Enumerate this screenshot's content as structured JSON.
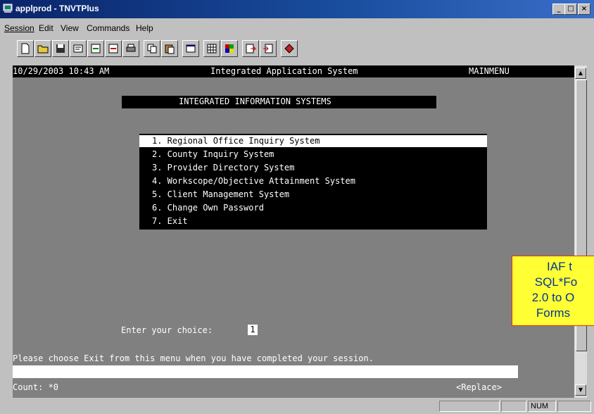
{
  "window": {
    "title": "applprod - TNVTPlus",
    "min": "_",
    "max": "□",
    "close": "×"
  },
  "menu": {
    "session": "Session",
    "edit": "Edit",
    "view": "View",
    "commands": "Commands",
    "help": "Help"
  },
  "toolbar": [
    "new-icon",
    "open-icon",
    "save-icon",
    "properties-icon",
    "connect-icon",
    "disconnect-icon",
    "print-icon",
    "copy-icon",
    "paste-icon",
    "window-icon",
    "grid-icon",
    "color-icon",
    "send-icon",
    "receive-icon",
    "macro-icon"
  ],
  "terminal": {
    "datetime": "10/29/2003 10:43 AM",
    "app_title": "Integrated Application System",
    "screen_id": "MAINMENU",
    "banner": "INTEGRATED INFORMATION SYSTEMS",
    "menu_items": [
      "1. Regional Office Inquiry System",
      "2. County Inquiry System",
      "3. Provider Directory System",
      "4. Workscope/Objective Attainment System",
      "5. Client Management System",
      "6. Change Own Password",
      "7. Exit"
    ],
    "prompt": "Enter your choice:",
    "choice_value": "1",
    "message": "Please choose Exit from this menu when you have completed your session.",
    "count": "Count: *0",
    "mode": "<Replace>"
  },
  "status": {
    "num": "NUM"
  },
  "note": {
    "lines": [
      "IAF t",
      "SQL*Fo",
      "2.0 to O",
      "Forms"
    ]
  }
}
